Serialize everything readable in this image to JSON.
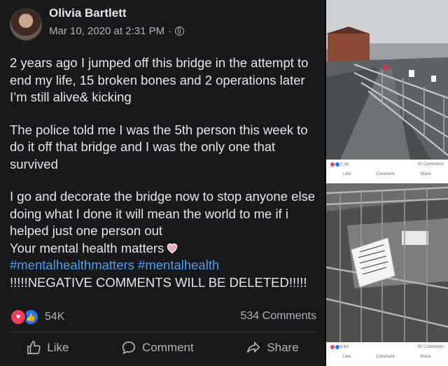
{
  "post": {
    "author": "Olivia Bartlett",
    "timestamp": "Mar 10, 2020 at 2:31 PM",
    "separator": "·",
    "paragraph1": "2 years ago I jumped off this bridge in the attempt to end my life, 15 broken bones and 2 operations later I’m still alive& kicking",
    "paragraph2": "The police told me I was the 5th person this week to do it off that bridge and I was the only one that survived",
    "paragraph3": "I go and decorate the bridge now to stop anyone else doing what I done it will mean the world to me if i helped just one person out",
    "line_mental": "Your mental health matters",
    "hashtags": "#mentalhealthmatters #mentalhealth",
    "warning": "!!!!!NEGATIVE COMMENTS WILL BE DELETED!!!!!",
    "reaction_count": "54K",
    "comments_count": "534 Comments",
    "actions": {
      "like": "Like",
      "comment": "Comment",
      "share": "Share"
    }
  },
  "photo1_bar": {
    "reactions": "2.3K",
    "comments": "41 Comments",
    "like": "Like",
    "comment": "Comment",
    "share": "Share"
  },
  "photo2_bar": {
    "reactions": "6.6K",
    "comments": "90 Comments",
    "like": "Like",
    "comment": "Comment",
    "share": "Share"
  },
  "photo2_note": "The STRONG Become less... you are worth ...",
  "colors": {
    "background": "#18191a",
    "text": "#e4e6eb",
    "muted": "#b0b3b8",
    "hashtag": "#4b9ef5",
    "love": "#f33e58",
    "like": "#2078f4"
  },
  "icons": [
    "globe-icon",
    "heart-emoji",
    "love-reaction-icon",
    "like-reaction-icon",
    "thumbs-up-icon",
    "comment-icon",
    "share-icon"
  ]
}
